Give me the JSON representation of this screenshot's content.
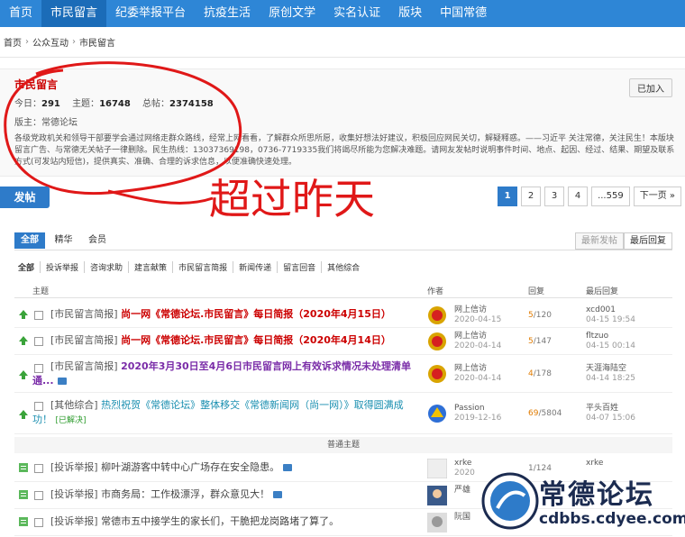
{
  "nav": [
    "首页",
    "市民留言",
    "纪委举报平台",
    "抗疫生活",
    "原创文学",
    "实名认证",
    "版块",
    "中国常德"
  ],
  "breadcrumb": [
    "首页",
    "公众互动",
    "市民留言"
  ],
  "forum": {
    "name": "市民留言",
    "today_label": "今日：",
    "today": "291",
    "topics_label": "主题：",
    "topics": "16748",
    "posts_label": "总帖：",
    "posts": "2374158",
    "moderators": "版主：常德论坛",
    "desc": "各级党政机关和领导干部要学会通过网络走群众路线，经常上网看看，了解群众所思所愿，收集好想法好建议，积极回应网民关切，解疑释惑。——习近平 关注常德，关注民生！本版块留言广告、与常德无关帖子一律删除。民生热线：13037369198，0736-7719335我们将竭尽所能为您解决难题。请网友发帖时说明事件时间、地点、起因、经过、结果、期望及联系方式(可发站内短信)，提供真实、准确、合理的诉求信息，以便准确快速处理。",
    "join_label": "已加入"
  },
  "annotation": "超过昨天",
  "post_label": "发帖",
  "pager": [
    "1",
    "2",
    "3",
    "4",
    "...559",
    "下一页 »"
  ],
  "tabs": [
    "全部",
    "精华",
    "会员"
  ],
  "sort": [
    "最新发帖",
    "最后回复"
  ],
  "cats": [
    "全部",
    "投诉举报",
    "咨询求助",
    "建言献策",
    "市民留言简报",
    "新闻传递",
    "留言回音",
    "其他综合"
  ],
  "table_head": {
    "topic": "主题",
    "author": "作者",
    "reply": "回复",
    "last": "最后回复"
  },
  "rows": [
    {
      "type": "[市民留言简报]",
      "title": "尚一网《常德论坛.市民留言》每日简报（2020年4月15日）",
      "author": "网上信访",
      "date": "2020-04-15",
      "rep": "5",
      "views": "/120",
      "last_user": "xcd001",
      "last_date": "04-15 19:54"
    },
    {
      "type": "[市民留言简报]",
      "title": "尚一网《常德论坛.市民留言》每日简报（2020年4月14日）",
      "author": "网上信访",
      "date": "2020-04-14",
      "rep": "5",
      "views": "/147",
      "last_user": "fltzuo",
      "last_date": "04-15 00:14"
    },
    {
      "type": "[市民留言简报]",
      "title": "2020年3月30日至4月6日市民留言网上有效诉求情况未处理清单",
      "title2": "通...",
      "author": "网上信访",
      "date": "2020-04-14",
      "rep": "4",
      "views": "/178",
      "last_user": "天涯海陆空",
      "last_date": "04-14 18:25"
    },
    {
      "type": "[其他综合]",
      "title": "热烈祝贺《常德论坛》整体移交《常德新闻网（尚一网）》取得圆满成",
      "title2": "功！",
      "solved": "[已解决]",
      "author": "Passion",
      "date": "2019-12-16",
      "rep": "69",
      "views": "/5804",
      "last_user": "平头百姓",
      "last_date": "04-07 15:06"
    }
  ],
  "normal_divider": "普通主题",
  "normal_rows": [
    {
      "type": "[投诉举报]",
      "title": "柳叶湖游客中转中心广场存在安全隐患。",
      "author": "xrke",
      "date": "2020",
      "rep": "1",
      "views": "/124",
      "last_user": "xrke"
    },
    {
      "type": "[投诉举报]",
      "title": "市商务局：工作极漂浮，群众意见大！",
      "author": "严雄",
      "date": "",
      "rep": "",
      "views": "",
      "last_user": ""
    },
    {
      "type": "[投诉举报]",
      "title": "常德市五中接学生的家长们，干脆把龙岗路堵了算了。",
      "author": "阮国",
      "date": "",
      "rep": "",
      "views": "",
      "last_user": ""
    }
  ],
  "watermark": {
    "text": "常德论坛",
    "url": "cdbbs.cdyee.com",
    "seal": "常德论坛"
  }
}
